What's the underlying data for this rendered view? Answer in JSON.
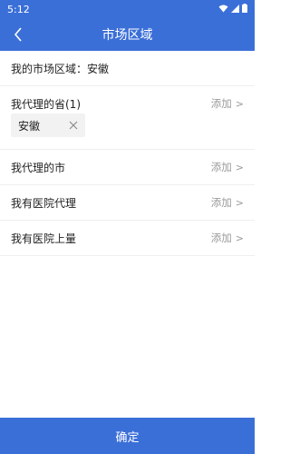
{
  "status_bar": {
    "time": "5:12"
  },
  "header": {
    "title": "市场区域"
  },
  "my_region": {
    "text": "我的市场区域：安徽"
  },
  "province": {
    "label": "我代理的省(1)",
    "add_label": "添加",
    "chips": [
      "安徽"
    ]
  },
  "rows": [
    {
      "label": "我代理的市",
      "add_label": "添加"
    },
    {
      "label": "我有医院代理",
      "add_label": "添加"
    },
    {
      "label": "我有医院上量",
      "add_label": "添加"
    }
  ],
  "footer": {
    "confirm_label": "确定"
  },
  "colors": {
    "primary": "#3b6fd8",
    "muted": "#9a9a9a",
    "chip_bg": "#f2f2f2"
  }
}
